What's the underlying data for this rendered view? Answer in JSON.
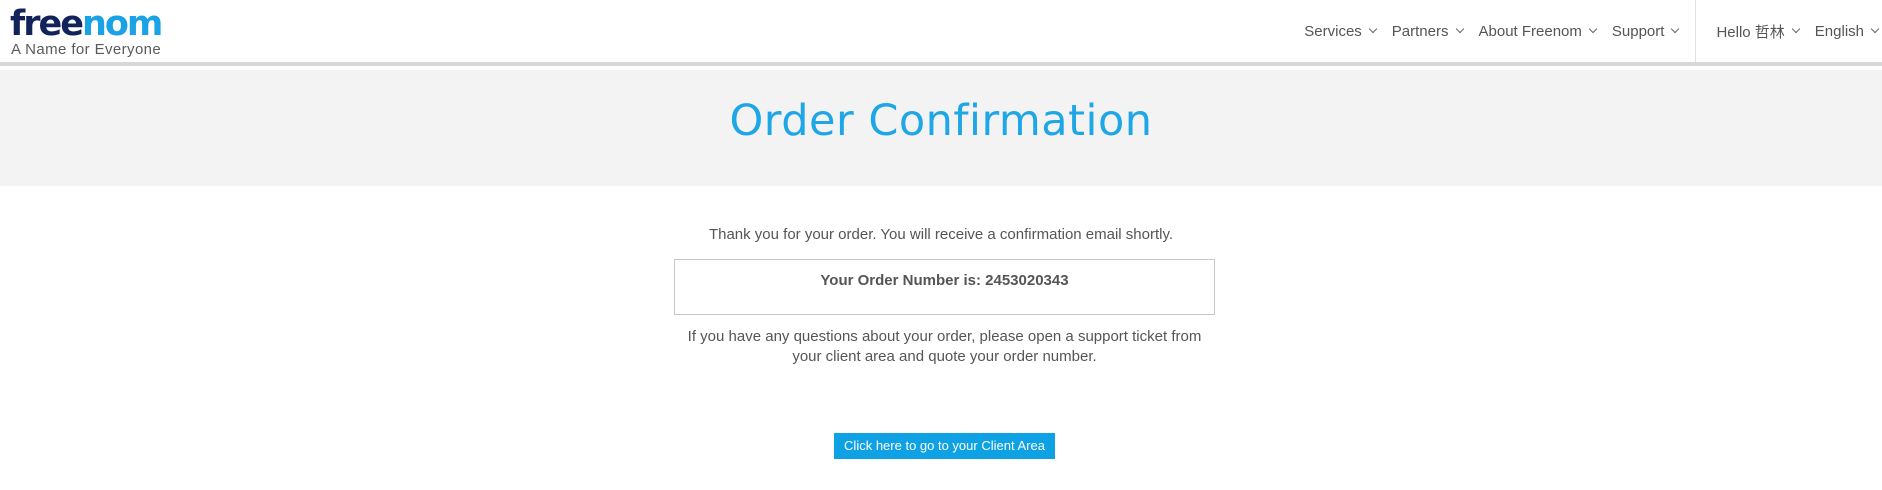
{
  "logo": {
    "word_dark": "free",
    "word_light": "nom",
    "tagline": "A Name for Everyone"
  },
  "nav": {
    "main": [
      {
        "label": "Services"
      },
      {
        "label": "Partners"
      },
      {
        "label": "About Freenom"
      },
      {
        "label": "Support"
      }
    ],
    "user": [
      {
        "label": "Hello 哲林"
      },
      {
        "label": "English"
      }
    ]
  },
  "page": {
    "title": "Order Confirmation"
  },
  "confirmation": {
    "thanks_text": "Thank you for your order. You will receive a confirmation email shortly.",
    "order_number_label": "Your Order Number is: 2453020343",
    "note": "If you have any questions about your order, please open a support ticket from your client area and quote your order number.",
    "client_area_button": "Click here to go to your Client Area"
  },
  "colors": {
    "brand_dark": "#12235b",
    "brand_light": "#1aa2e6",
    "title": "#1ea6e6",
    "button": "#0ea2e4",
    "band": "#f3f3f3"
  }
}
